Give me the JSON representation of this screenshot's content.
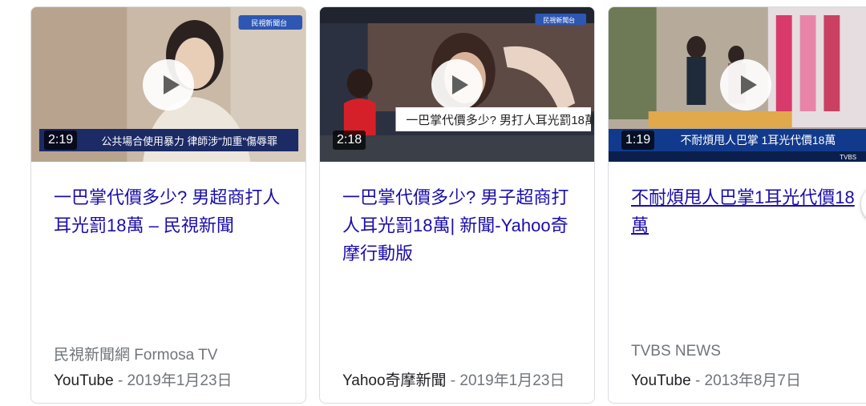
{
  "cards": [
    {
      "duration": "2:19",
      "title": "一巴掌代價多少? 男超商打人耳光罰18萬 – 民視新聞",
      "source": "民視新聞網 Formosa TV",
      "site": "YouTube",
      "date": " - 2019年1月23日",
      "overlay_text": "公共場合使用暴力 律師涉\"加重\"傷辱罪",
      "logo_text": "民視新聞台"
    },
    {
      "duration": "2:18",
      "title": "一巴掌代價多少? 男子超商打人耳光罰18萬| 新聞-Yahoo奇摩行動版",
      "source": "",
      "site": "Yahoo奇摩新聞",
      "date": " - 2019年1月23日",
      "overlay_text": "一巴掌代價多少? 男打人耳光罰18萬",
      "logo_text": "民視新聞台"
    },
    {
      "duration": "1:19",
      "title": "不耐煩甩人巴掌1耳光代價18萬",
      "source": "TVBS NEWS",
      "site": "YouTube",
      "date": " - 2013年8月7日",
      "overlay_text": "不耐煩甩人巴掌 1耳光代價18萬",
      "logo_text": "TVBS"
    }
  ]
}
